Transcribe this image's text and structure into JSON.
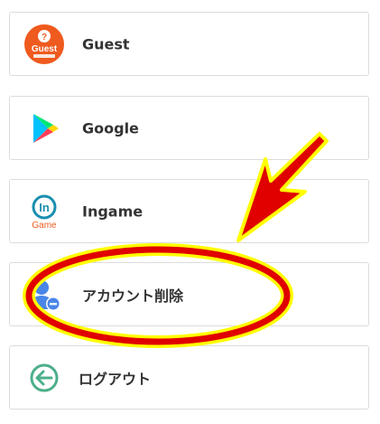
{
  "accounts": [
    {
      "id": "guest",
      "label": "Guest",
      "icon": "guest-icon",
      "icon_text": "Guest"
    },
    {
      "id": "google",
      "label": "Google",
      "icon": "google-play-icon"
    },
    {
      "id": "ingame",
      "label": "Ingame",
      "icon": "ingame-icon",
      "icon_text": "Game"
    },
    {
      "id": "delete",
      "label": "アカウント削除",
      "icon": "user-remove-icon"
    },
    {
      "id": "logout",
      "label": "ログアウト",
      "icon": "logout-icon"
    }
  ],
  "colors": {
    "border": "#dcdcdc",
    "label": "#333333",
    "annotation_red": "#e00000",
    "annotation_yellow": "#ffff00",
    "guest_orange": "#ef5a1e",
    "ingame_teal": "#1a8fb0",
    "user_blue": "#4a86e8",
    "logout_green": "#4caf8a"
  }
}
